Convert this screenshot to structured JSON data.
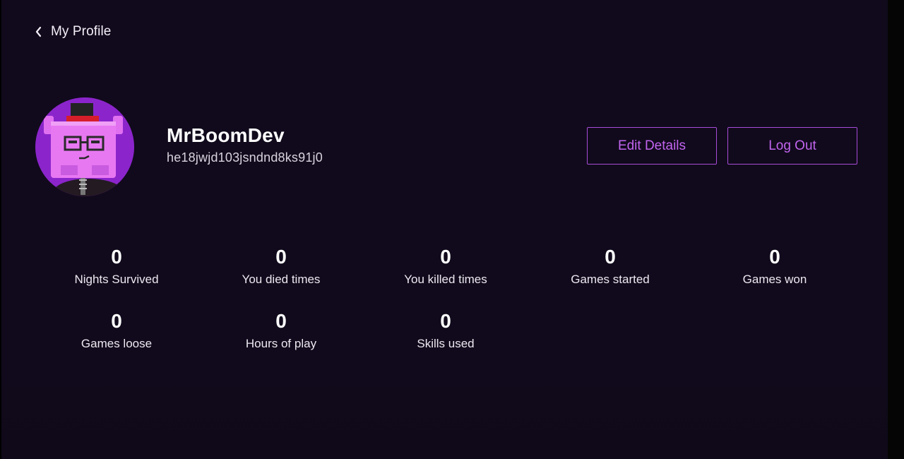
{
  "header": {
    "back_icon": "chevron-left-icon",
    "title": "My Profile"
  },
  "profile": {
    "avatar_icon": "robot-avatar-icon",
    "username": "MrBoomDev",
    "user_id": "he18jwjd103jsndnd8ks91j0"
  },
  "actions": {
    "edit_label": "Edit Details",
    "logout_label": "Log Out"
  },
  "stats": [
    {
      "value": "0",
      "label": "Nights Survived"
    },
    {
      "value": "0",
      "label": "You died times"
    },
    {
      "value": "0",
      "label": "You killed times"
    },
    {
      "value": "0",
      "label": "Games started"
    },
    {
      "value": "0",
      "label": "Games won"
    },
    {
      "value": "0",
      "label": "Games loose"
    },
    {
      "value": "0",
      "label": "Hours of play"
    },
    {
      "value": "0",
      "label": "Skills used"
    }
  ],
  "colors": {
    "background": "#110a1c",
    "accent": "#a84cd8",
    "accent_text": "#c265ef",
    "text": "#ffffff"
  }
}
